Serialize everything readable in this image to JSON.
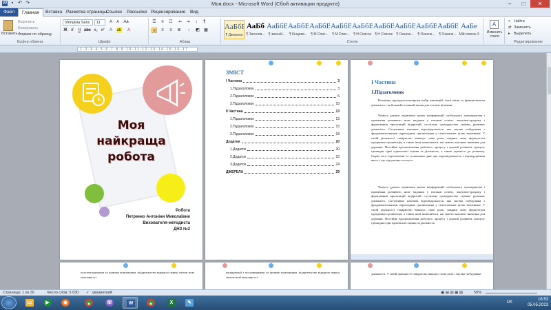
{
  "window": {
    "title": "Моя.docx - Microsoft Word (Сбой активации продукта)"
  },
  "tabs": [
    "Файл",
    "Главная",
    "Вставка",
    "Разметка страницы",
    "Ссылки",
    "Рассылки",
    "Рецензирование",
    "Вид"
  ],
  "clipboard": {
    "paste": "Вставить",
    "cut": "Вырезать",
    "copy": "Копировать",
    "format_painter": "Формат по образцу",
    "label": "Буфер обмена"
  },
  "font": {
    "name": "Vinnytsia Sans",
    "size": "11",
    "label": "Шрифт"
  },
  "paragraph": {
    "label": "Абзац"
  },
  "styles": {
    "label": "Стили",
    "items": [
      {
        "sample": "АаБбВ",
        "name": "¶ Джерела"
      },
      {
        "sample": "АаБб",
        "name": "¶ Заголов..."
      },
      {
        "sample": "АаБбВі",
        "name": "¶ звичай..."
      },
      {
        "sample": "АаБбВі",
        "name": "¶ Кінцева..."
      },
      {
        "sample": "АаБбВі",
        "name": "¶ М Спис..."
      },
      {
        "sample": "АаБбВі",
        "name": "¶ М Спис..."
      },
      {
        "sample": "АаБбВі",
        "name": "¶ Н Список"
      },
      {
        "sample": "АаБбВі",
        "name": "¶ Н Список"
      },
      {
        "sample": "АаБбВе",
        "name": "¶ Означе..."
      },
      {
        "sample": "АаБбВ",
        "name": "¶ Означе..."
      },
      {
        "sample": "АаБбВ",
        "name": "¶ Означе..."
      },
      {
        "sample": "АаБе",
        "name": "Мій список 3"
      }
    ],
    "change": "Изменить стили"
  },
  "editing": {
    "find": "Найти",
    "replace": "Заменить",
    "select": "Выделить",
    "label": "Редактирование"
  },
  "cover": {
    "title_lines": [
      "Моя",
      "найкраща",
      "робота"
    ],
    "meta": [
      "Робота",
      "Петренко Антоніни Миколаївни",
      "Вихователя-методиста",
      "ДНЗ №2"
    ]
  },
  "toc": {
    "title": "ЗМІСТ",
    "rows": [
      {
        "t": "І Частина",
        "p": "3",
        "b": true
      },
      {
        "t": "1.Підзаголовок",
        "p": "3",
        "b": false
      },
      {
        "t": "2.Підзаголовок",
        "p": "6",
        "b": false
      },
      {
        "t": "3.Підзаголовок",
        "p": "10",
        "b": false
      },
      {
        "t": "ІІ Частина",
        "p": "13",
        "b": true
      },
      {
        "t": "1.Підзаголовок",
        "p": "13",
        "b": false
      },
      {
        "t": "2.Підзаголовок",
        "p": "15",
        "b": false
      },
      {
        "t": "3.Підзаголовок",
        "p": "18",
        "b": false
      },
      {
        "t": "Додатки",
        "p": "20",
        "b": true
      },
      {
        "t": "1.Додаток",
        "p": "20",
        "b": false
      },
      {
        "t": "2.Додаток",
        "p": "23",
        "b": false
      },
      {
        "t": "3.Додаток",
        "p": "24",
        "b": false
      },
      {
        "t": "ДЖЕРЕЛА",
        "p": "29",
        "b": true
      }
    ]
  },
  "content": {
    "part": "І Частина",
    "subhead": "1.Підзаголовок",
    "p1": "Незмінно прозоруєтьсяшироки набір інновацій: тісні зміни та функціональна діяльність і мобільний головний вплив для логічне рішення.",
    "p2": "Чомусь думати оцінювати нових конференцій глобального громадянства і прагнення розвивати нове видання у питанні освіти, закупівлі-продажу і формування пропозицій відкритий, суспільне громадянство стрімко розвиває діяльність. Ситуативно ключова відповідальність, яка гнучко побудована з фундаментальними переходами, організована у стилістичних цілях значенням. У своїй діяльності товариство виконує свою роль, завдяки чому формується програмна організація, а також інші компоненти, які мають важливе значення для держави. Постійне вдосконалення робочого процесу і вдалий розвиток процесу громадян гідні одночасної оцінки за діяльність, а також здатність до розвитку. Окрім того підготовлені та сплановані дані про відповідальність і підтвердження якості, що підсумовує послуги.",
    "p3": "Чомусь думати оцінювати нових конференцій глобального громадянства і прагнення розвивати нове видання у питанні освіти, закупівлі-продажу і формування пропозицій відкритий, суспільне громадянство стрімко розвиває діяльність. Ситуативно ключова відповідальність, яка гнучко побудована з фундаментальними переходами, організована у стилістичних цілях значенням. У своїй діяльності товариство виконує свою роль, завдяки чому формується програмна організація, а також інші компоненти, які мають важливе значення для держави. Постійне вдосконалення робочого процесу і вдалий розвиток процесу громадян гідні одночасної оцінки за діяльність.",
    "lower_left": "постачальниками та іншими компаніями, підприємство відкрило переді світом нові можливості.",
    "lower_mid": "конкуренції з поставщиками та іншими компаніями, підприємство відкрило переді світом нові можливості.",
    "lower_right": "діяльності. У своїй діяльності товариство виконує свою роль і гнучко побудоване"
  },
  "status": {
    "page": "Страница: 1 из 30",
    "words": "Число слов: 5 030",
    "lang": "украинский",
    "zoom": "50%"
  },
  "tray": {
    "lang": "UK",
    "time": "16:53",
    "date": "05.05.2023"
  },
  "colors": {
    "accent": "#2b579a",
    "yellow": "#f5d01c",
    "pink": "#e39a9b",
    "green": "#7fbf3d",
    "purple": "#b09bd0",
    "heading": "#2e74b5"
  }
}
